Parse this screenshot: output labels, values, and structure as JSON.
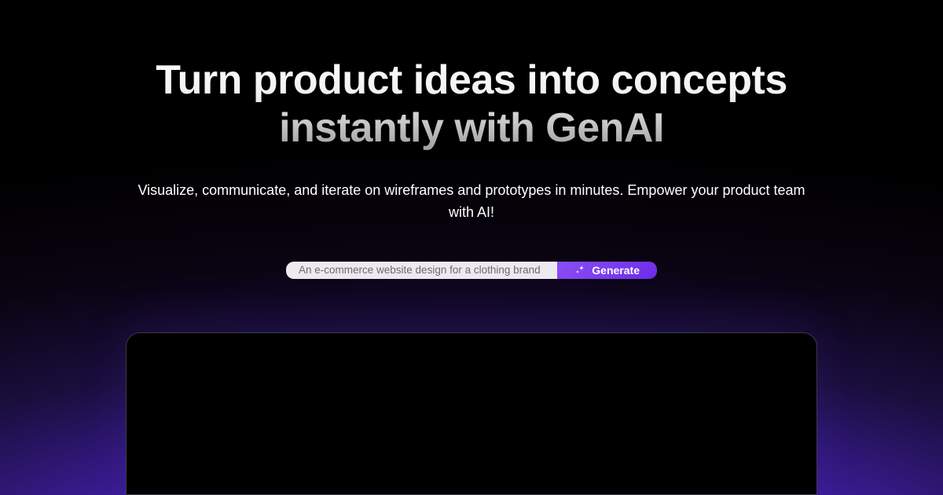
{
  "hero": {
    "headline": "Turn product ideas into concepts instantly with GenAI",
    "subhead": "Visualize, communicate, and iterate on wireframes and prototypes in minutes. Empower your product team with AI!"
  },
  "prompt": {
    "placeholder": "An e-commerce website design for a clothing brand",
    "button_label": "Generate"
  }
}
